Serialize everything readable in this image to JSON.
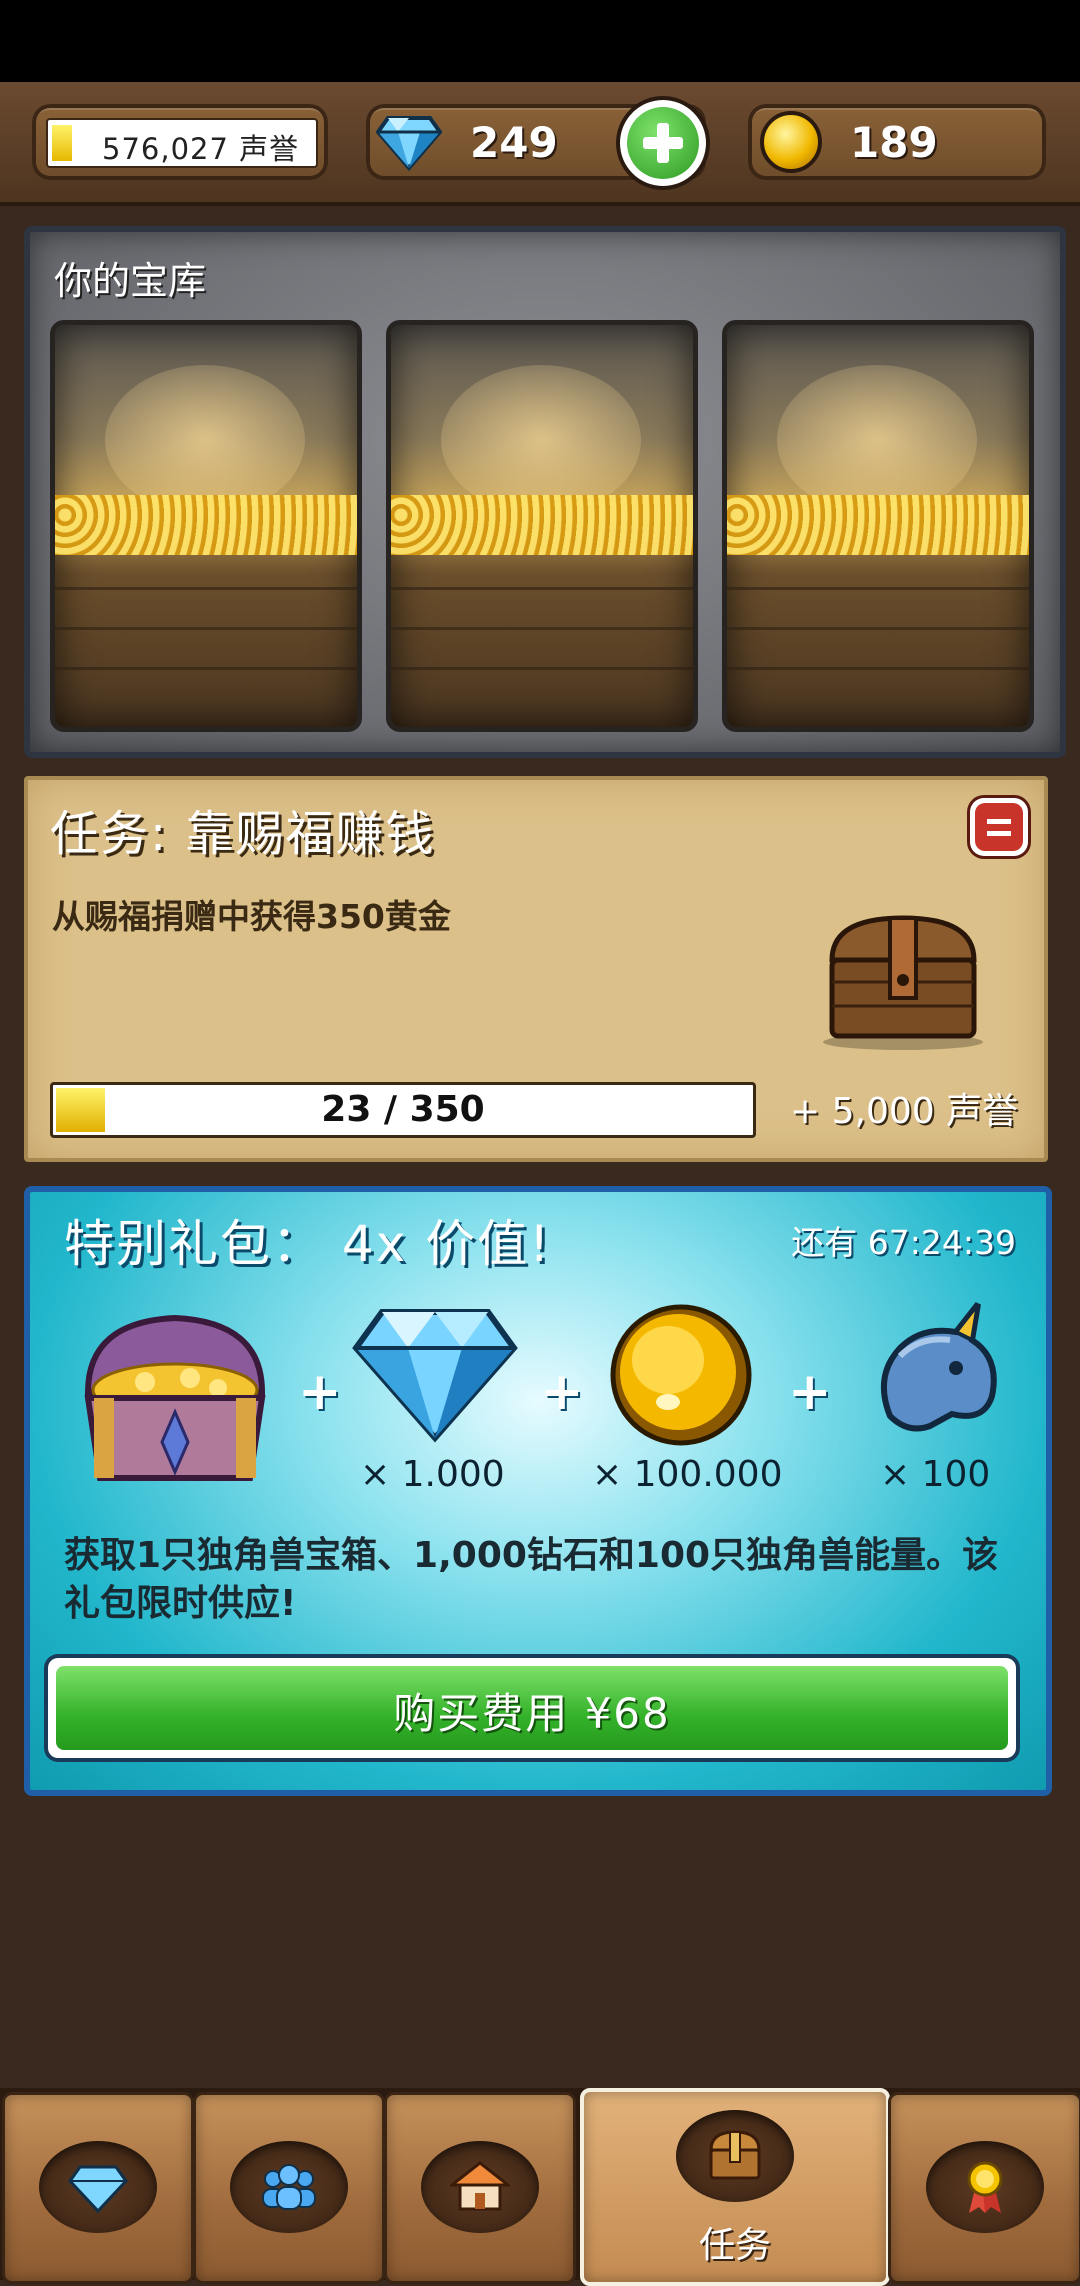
{
  "topbar": {
    "reputation_value": "576,027 声誉",
    "reputation_fill": 0.07,
    "gems_value": "249",
    "gold_value": "189"
  },
  "vault": {
    "title": "你的宝库",
    "slot_count": 3
  },
  "quest": {
    "title": "任务: 靠赐福赚钱",
    "description": "从赐福捐赠中获得350黄金",
    "progress_current": 23,
    "progress_max": 350,
    "progress_text": "23 / 350",
    "reward": "+ 5,000 声誉"
  },
  "offer": {
    "title": "特别礼包： 4x 价值!",
    "timer": "还有 67:24:39",
    "items": [
      {
        "icon": "unicorn-chest-icon",
        "qty": ""
      },
      {
        "icon": "diamond-icon",
        "qty": "× 1.000"
      },
      {
        "icon": "gold-coin-icon",
        "qty": "× 100.000"
      },
      {
        "icon": "unicorn-energy-icon",
        "qty": "× 100"
      }
    ],
    "plus": "+",
    "description": "获取1只独角兽宝箱、1,000钻石和100只独角兽能量。该礼包限时供应!",
    "buy_label": "购买费用 ¥68"
  },
  "nav": {
    "tabs": [
      {
        "icon": "diamond-icon",
        "label": ""
      },
      {
        "icon": "people-icon",
        "label": ""
      },
      {
        "icon": "house-icon",
        "label": ""
      },
      {
        "icon": "treasure-chest-icon",
        "label": "任务",
        "active": true
      },
      {
        "icon": "medal-icon",
        "label": ""
      }
    ]
  },
  "colors": {
    "wood": "#6b4a30",
    "offer_teal": "#22b7cc",
    "buy_green": "#34b22a",
    "progress_yellow": "#f0c800"
  }
}
